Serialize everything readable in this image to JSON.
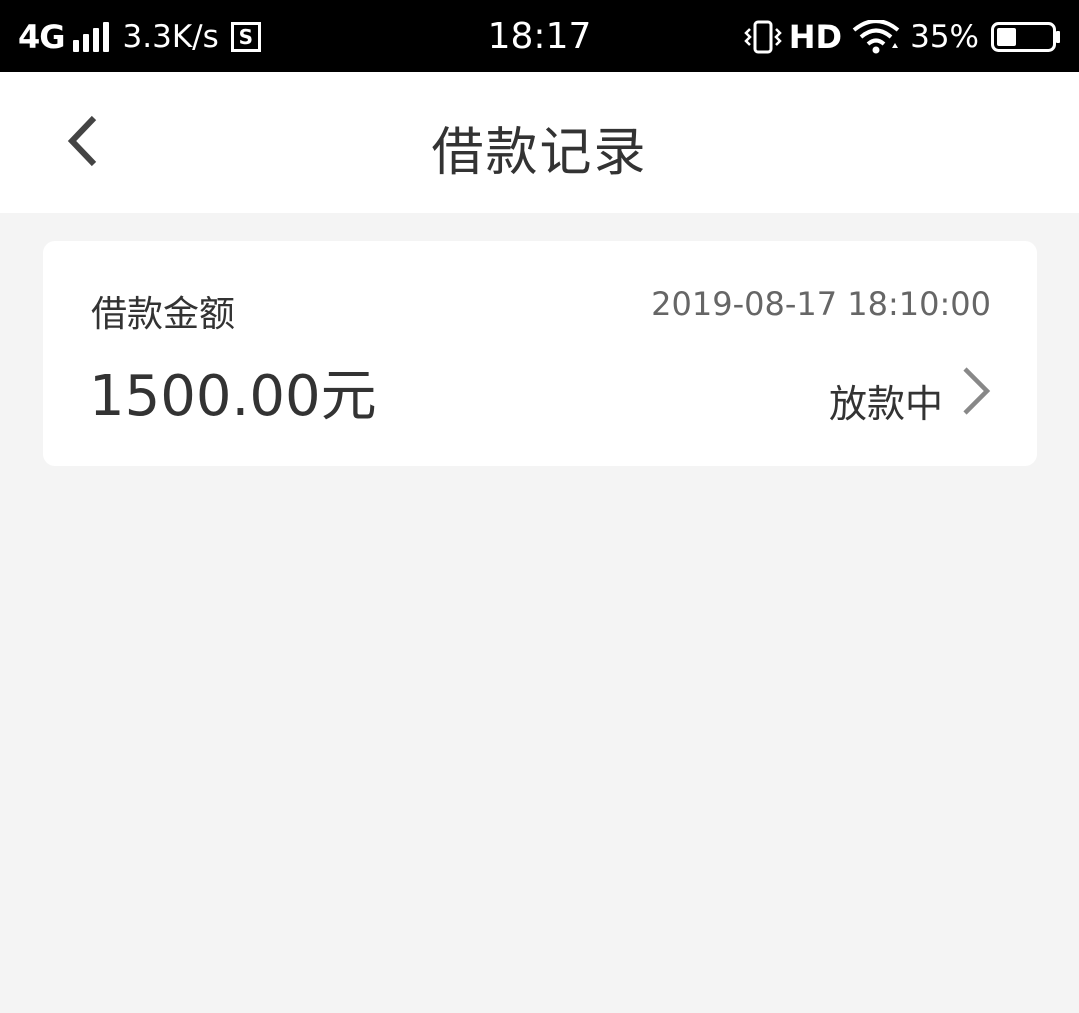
{
  "status_bar": {
    "network": "4G",
    "speed": "3.3K/s",
    "s_icon_label": "S",
    "time": "18:17",
    "hd": "HD",
    "battery": "35%",
    "battery_level": 0.35
  },
  "nav": {
    "title": "借款记录"
  },
  "record": {
    "label": "借款金额",
    "date": "2019-08-17 18:10:00",
    "amount": "1500.00元",
    "status": "放款中"
  }
}
